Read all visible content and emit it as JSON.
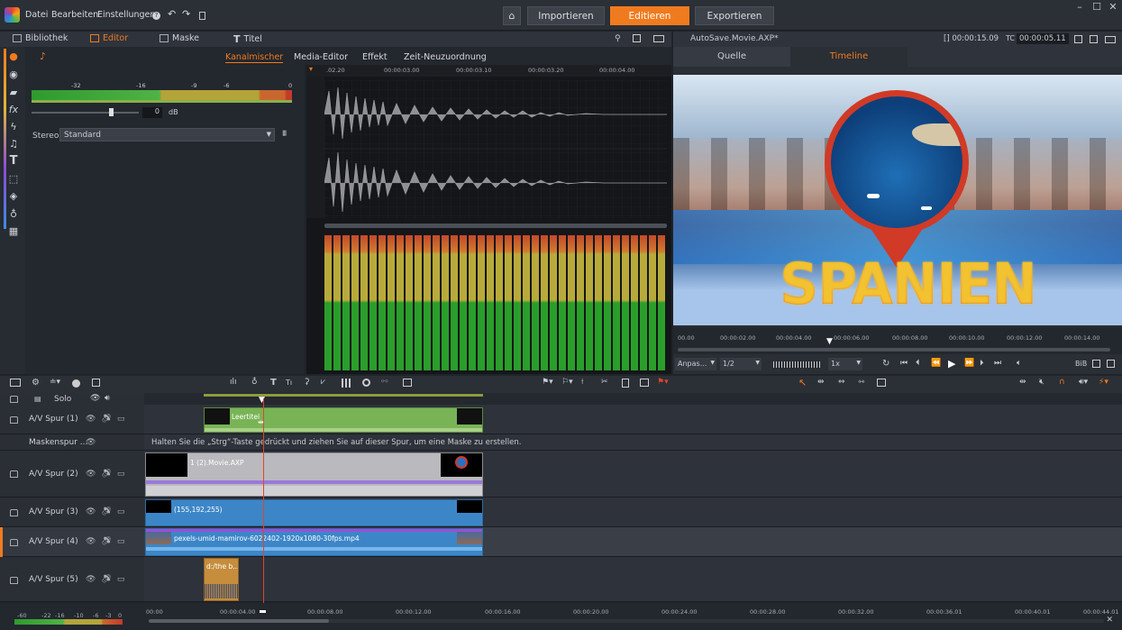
{
  "menu": {
    "datei": "Datei",
    "bearbeiten": "Bearbeiten",
    "einstellungen": "Einstellungen",
    "help": "?"
  },
  "modes": {
    "importieren": "Importieren",
    "editieren": "Editieren",
    "exportieren": "Exportieren"
  },
  "left_tabs": {
    "bibliothek": "Bibliothek",
    "editor": "Editor",
    "maske": "Maske",
    "titel": "Titel"
  },
  "preview_header": {
    "title": "AutoSave.Movie.AXP*",
    "tc_in": "[] 00:00:15.09",
    "tc_label": "TC",
    "tc_value": "00:00:05.11"
  },
  "preview_tabs": {
    "quelle": "Quelle",
    "timeline": "Timeline"
  },
  "sub_tabs": {
    "kanalmischer": "Kanalmischer",
    "media_editor": "Media-Editor",
    "effekt": "Effekt",
    "zeit": "Zeit-Neuzuordnung"
  },
  "meter": {
    "labels": [
      "-32",
      "-16",
      "-9",
      "-6",
      "0"
    ],
    "gain_value": "0",
    "gain_unit": "dB"
  },
  "stereo": {
    "label": "Stereo",
    "value": "Standard"
  },
  "wave_ruler": [
    ".02.20",
    "00:00:03.00",
    "00:00:03.10",
    "00:00:03.20",
    "00:00:04.00"
  ],
  "preview_ruler": [
    "00.00",
    "00:00:02.00",
    "00:00:04.00",
    "00:00:06.00",
    "00:00:08.00",
    "00:00:10.00",
    "00:00:12.00",
    "00:00:14.00"
  ],
  "preview_controls": {
    "fit": "Anpas...",
    "ratio": "1/2",
    "speed": "1x",
    "bib": "BiB"
  },
  "title_text": "SPANIEN",
  "tracks": {
    "solo": "Solo",
    "t1": "A/V Spur (1)",
    "mask": "Maskenspur ...",
    "mask_hint": "Halten Sie die „Strg“-Taste gedrückt und ziehen Sie auf dieser Spur, um eine Maske zu erstellen.",
    "t2": "A/V Spur (2)",
    "t3": "A/V Spur (3)",
    "t4": "A/V Spur (4)",
    "t5": "A/V Spur (5)"
  },
  "clips": {
    "leertitel": "Leertitel",
    "movie": "1 (2).Movie.AXP",
    "color": "(155,192,255)",
    "video": "pexels-umid-mamirov-6022402-1920x1080-30fps.mp4",
    "audio": "d:/the b..."
  },
  "timeline_ruler": [
    "00:00",
    "00:00:04.00",
    "00:00:08.00",
    "00:00:12.00",
    "00:00:16.00",
    "00:00:20.00",
    "00:00:24.00",
    "00:00:28.00",
    "00:00:32.00",
    "00:00:36.01",
    "00:00:40.01",
    "00:00:44.01"
  ],
  "bottom_meter": [
    "-60",
    "-22",
    "-16",
    "-10",
    "-6",
    "-3",
    "0"
  ],
  "colors": {
    "accent": "#f07b1e",
    "bg": "#1f232a",
    "track_green": "#78b456",
    "track_blue": "#3c86c8",
    "track_gray": "#b9b9be"
  }
}
